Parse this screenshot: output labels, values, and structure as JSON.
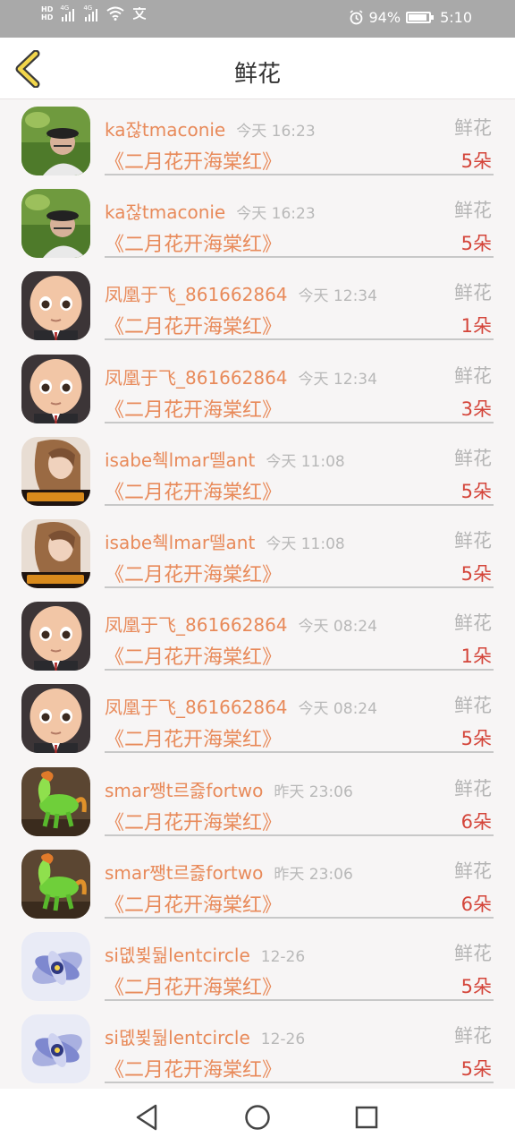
{
  "status_bar": {
    "hd1": "HD",
    "hd2": "HD",
    "net1": "4G",
    "net2": "4G",
    "battery_pct": "94%",
    "time": "5:10",
    "icons": [
      "signal-icon",
      "wifi-icon",
      "language-icon",
      "alarm-icon",
      "battery-icon"
    ]
  },
  "header": {
    "title": "鲜花",
    "back_icon": "chevron-left-icon"
  },
  "gifts": [
    {
      "user": "ka잖tmaconie",
      "time": "今天 16:23",
      "type": "鲜花",
      "gift": "《二月花开海棠红》",
      "count": "5朵",
      "avatar": "man-with-cap"
    },
    {
      "user": "ka잖tmaconie",
      "time": "今天 16:23",
      "type": "鲜花",
      "gift": "《二月花开海棠红》",
      "count": "5朵",
      "avatar": "man-with-cap"
    },
    {
      "user": "凤凰于飞_861662864",
      "time": "今天 12:34",
      "type": "鲜花",
      "gift": "《二月花开海棠红》",
      "count": "1朵",
      "avatar": "cartoon-baby"
    },
    {
      "user": "凤凰于飞_861662864",
      "time": "今天 12:34",
      "type": "鲜花",
      "gift": "《二月花开海棠红》",
      "count": "3朵",
      "avatar": "cartoon-baby"
    },
    {
      "user": "isabe췍lmar뗄ant",
      "time": "今天 11:08",
      "type": "鲜花",
      "gift": "《二月花开海棠红》",
      "count": "5朵",
      "avatar": "woman-portrait"
    },
    {
      "user": "isabe췍lmar뗄ant",
      "time": "今天 11:08",
      "type": "鲜花",
      "gift": "《二月花开海棠红》",
      "count": "5朵",
      "avatar": "woman-portrait"
    },
    {
      "user": "凤凰于飞_861662864",
      "time": "今天 08:24",
      "type": "鲜花",
      "gift": "《二月花开海棠红》",
      "count": "1朵",
      "avatar": "cartoon-baby"
    },
    {
      "user": "凤凰于飞_861662864",
      "time": "今天 08:24",
      "type": "鲜花",
      "gift": "《二月花开海棠红》",
      "count": "5朵",
      "avatar": "cartoon-baby"
    },
    {
      "user": "smar쨍t르즗fortwo",
      "time": "昨天 23:06",
      "type": "鲜花",
      "gift": "《二月花开海棠红》",
      "count": "6朵",
      "avatar": "jade-horse"
    },
    {
      "user": "smar쨍t르즗fortwo",
      "time": "昨天 23:06",
      "type": "鲜花",
      "gift": "《二月花开海棠红》",
      "count": "6朵",
      "avatar": "jade-horse"
    },
    {
      "user": "si뎺뵟둶lentcircle",
      "time": "12-26",
      "type": "鲜花",
      "gift": "《二月花开海棠红》",
      "count": "5朵",
      "avatar": "blue-flower"
    },
    {
      "user": "si뎺뵟둶lentcircle",
      "time": "12-26",
      "type": "鲜花",
      "gift": "《二月花开海棠红》",
      "count": "5朵",
      "avatar": "blue-flower"
    }
  ],
  "nav_bar": {
    "icons": [
      "back-triangle-icon",
      "home-circle-icon",
      "recents-square-icon"
    ]
  },
  "colors": {
    "accent": "#e88a5a",
    "count": "#d4453a",
    "muted": "#b5b5b5",
    "status_bar": "#a9a9a9"
  }
}
